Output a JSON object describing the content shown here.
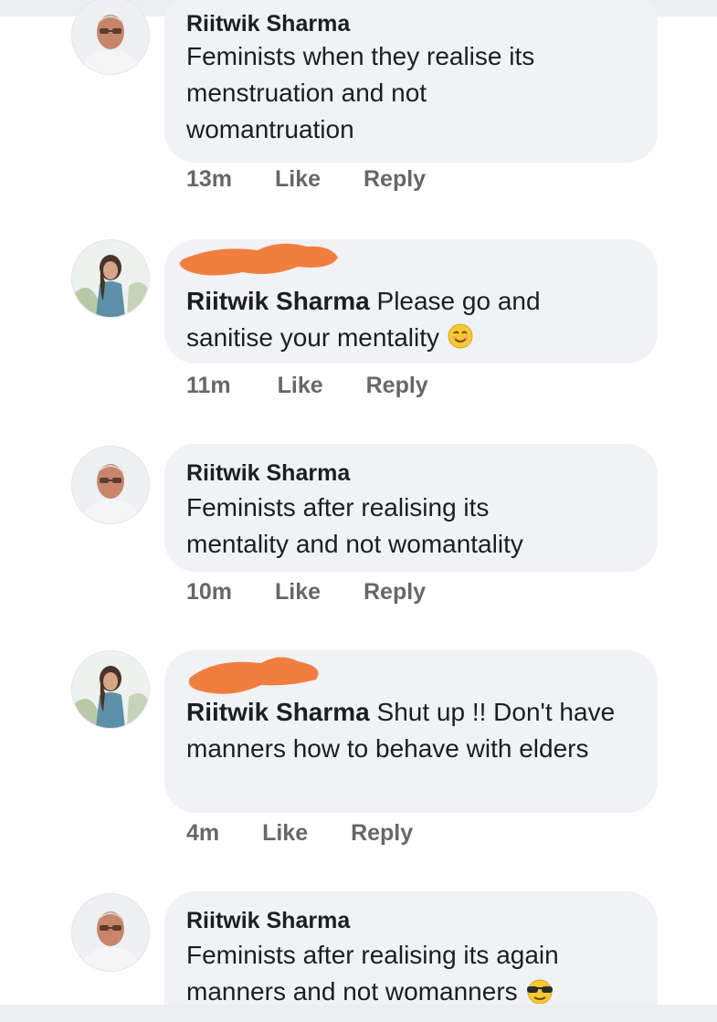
{
  "comments": [
    {
      "author": "Riitwik Sharma",
      "text": "Feminists when they realise its menstruation and not womantruation",
      "time": "13m",
      "like_label": "Like",
      "reply_label": "Reply"
    },
    {
      "mention": "Riitwik Sharma",
      "text": "Please go and sanitise your mentality",
      "emoji": "smiling-face-emoji",
      "time": "11m",
      "like_label": "Like",
      "reply_label": "Reply"
    },
    {
      "author": "Riitwik Sharma",
      "text": "Feminists after realising its mentality and not womantality",
      "time": "10m",
      "like_label": "Like",
      "reply_label": "Reply"
    },
    {
      "mention": "Riitwik Sharma",
      "text": "Shut up !! Don't have manners how to behave with elders",
      "time": "4m",
      "like_label": "Like",
      "reply_label": "Reply"
    },
    {
      "author": "Riitwik Sharma",
      "text": "Feminists after realising its again manners and not womanners",
      "emoji": "sunglasses-emoji"
    }
  ],
  "colors": {
    "bubble": "#f0f2f5",
    "meta": "#65676b",
    "redaction": "#f07f3f"
  }
}
